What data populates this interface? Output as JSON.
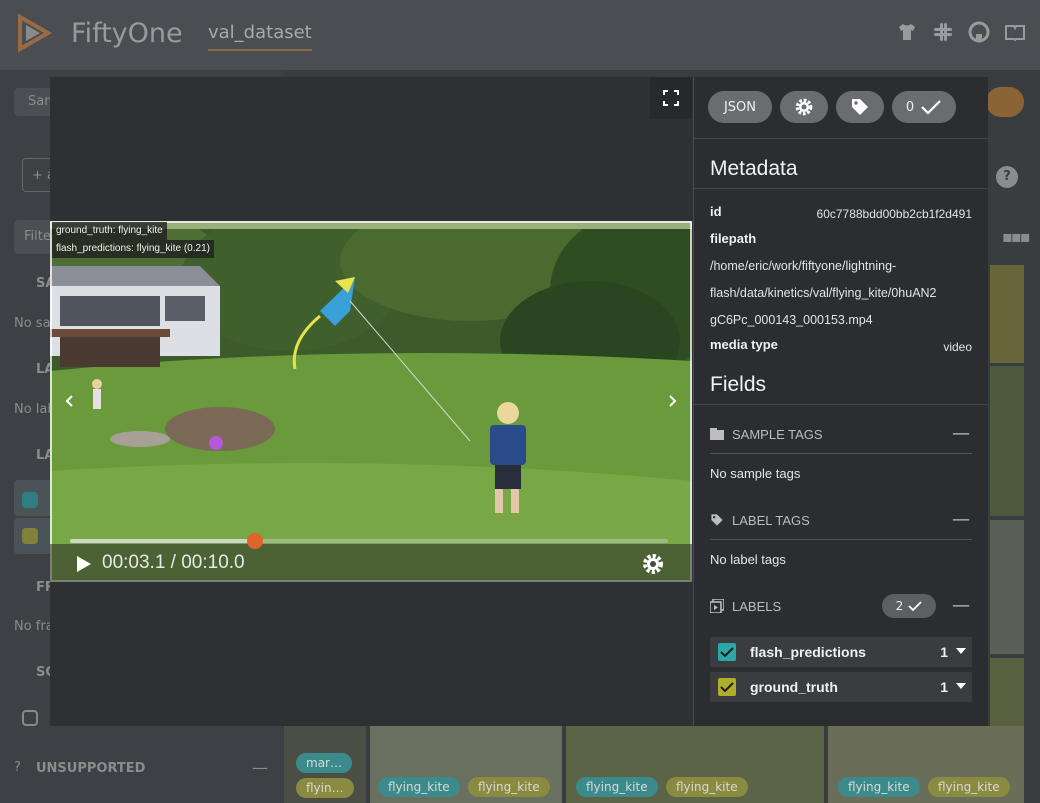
{
  "header": {
    "brand": "FiftyOne",
    "dataset": "val_dataset",
    "icons": [
      "tshirt-icon",
      "slack-icon",
      "github-icon",
      "book-icon"
    ]
  },
  "background": {
    "sidebar_bits": {
      "samples_tab": "Sam",
      "add_stage": "+ a",
      "filter": "Filte",
      "sample_tags_head": "SA",
      "no_sample": "No sam",
      "label_tags_head": "LA",
      "no_label": "No lab",
      "labels_head": "LA",
      "frame_head": "FR",
      "no_frame": "No fra",
      "scalars_head": "SC",
      "unsupported": "UNSUPPORTED"
    },
    "grid_chips": [
      "mar…",
      "flyin…",
      "flying_kite",
      "flying_kite",
      "flying_kite",
      "flying_kite",
      "flying_kite",
      "flying_kite"
    ]
  },
  "viewer": {
    "overlay_labels": [
      "ground_truth: flying_kite",
      "flash_predictions: flying_kite (0.21)"
    ],
    "time": "00:03.1 / 00:10.0",
    "progress": 0.31
  },
  "panel": {
    "actions": {
      "json": "JSON",
      "count": "0"
    },
    "metadata_title": "Metadata",
    "metadata": {
      "id_key": "id",
      "id_val": "60c7788bdd00bb2cb1f2d491",
      "filepath_key": "filepath",
      "filepath_lines": [
        "/home/eric/work/fiftyone/lightning-",
        "flash/data/kinetics/val/flying_kite/0huAN2",
        "gC6Pc_000143_000153.mp4"
      ],
      "media_key": "media type",
      "media_val": "video"
    },
    "fields_title": "Fields",
    "sample_tags": {
      "title": "SAMPLE TAGS",
      "empty": "No sample tags"
    },
    "label_tags": {
      "title": "LABEL TAGS",
      "empty": "No label tags"
    },
    "labels": {
      "title": "LABELS",
      "count": "2",
      "items": [
        {
          "name": "flash_predictions",
          "count": "1",
          "color": "#2aa8a8"
        },
        {
          "name": "ground_truth",
          "count": "1",
          "color": "#b0ad2a"
        }
      ]
    }
  }
}
